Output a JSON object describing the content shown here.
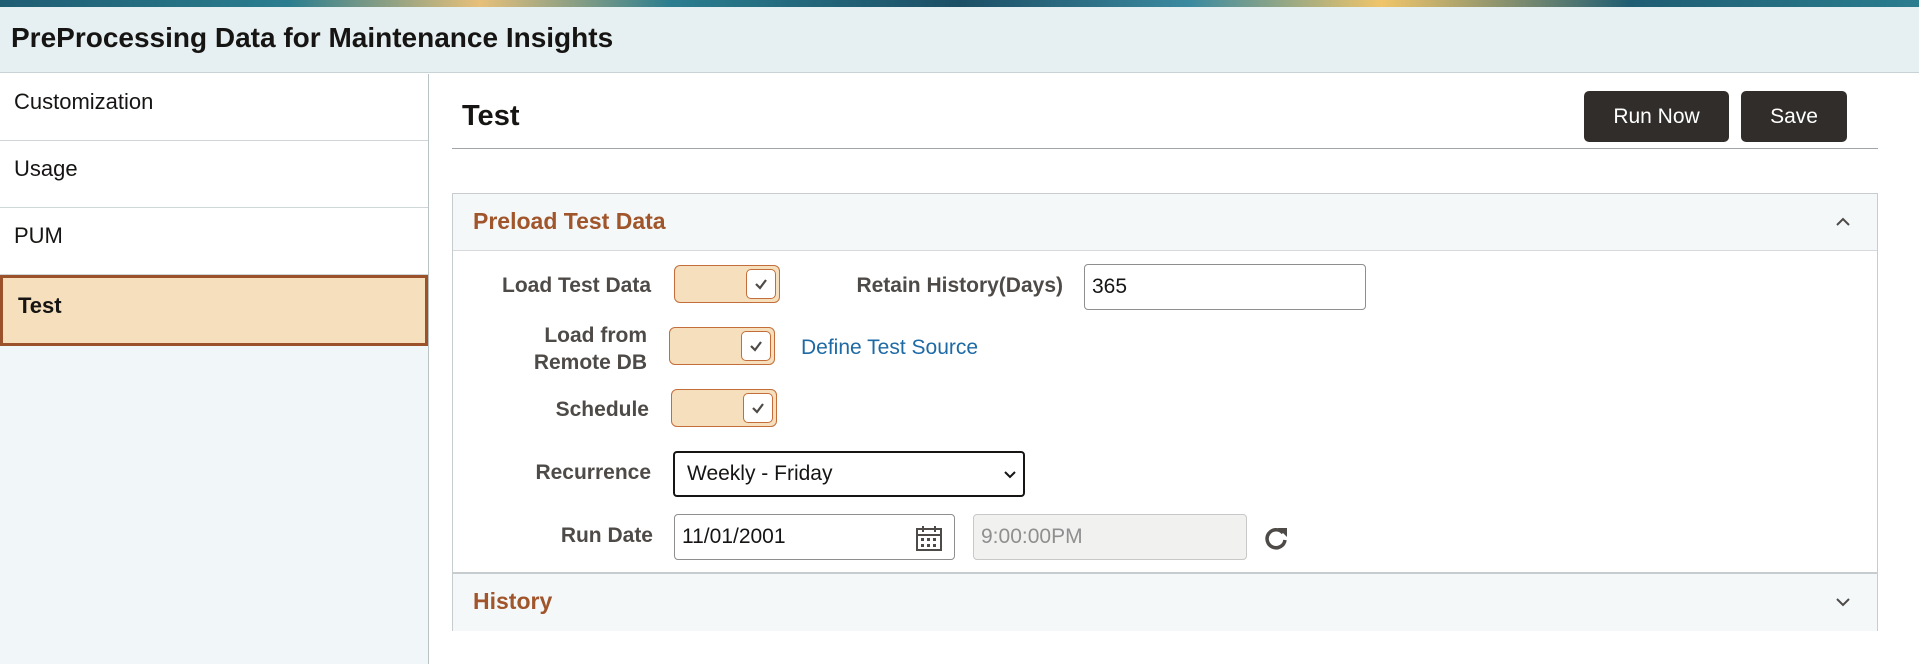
{
  "header": {
    "title": "PreProcessing Data for Maintenance Insights"
  },
  "sidebar": {
    "items": [
      {
        "label": "Customization"
      },
      {
        "label": "Usage"
      },
      {
        "label": "PUM"
      },
      {
        "label": "Test",
        "selected": true
      }
    ]
  },
  "main": {
    "title": "Test",
    "run_now_label": "Run Now",
    "save_label": "Save"
  },
  "preload": {
    "title": "Preload Test Data",
    "load_test_data_label": "Load Test Data",
    "load_test_data_checked": true,
    "retain_history_label": "Retain History(Days)",
    "retain_history_value": "365",
    "load_remote_label_line1": "Load from",
    "load_remote_label_line2": "Remote DB",
    "load_remote_checked": true,
    "define_source_link": "Define Test Source",
    "schedule_label": "Schedule",
    "schedule_checked": true,
    "recurrence_label": "Recurrence",
    "recurrence_value": "Weekly - Friday",
    "run_date_label": "Run Date",
    "run_date_value": "11/01/2001",
    "run_time_value": "9:00:00PM"
  },
  "history": {
    "title": "History"
  },
  "colors": {
    "accent": "#a0552a",
    "toggle_bg": "#f5dfbd",
    "button_bg": "#312d2a",
    "link": "#1e6aa5"
  }
}
